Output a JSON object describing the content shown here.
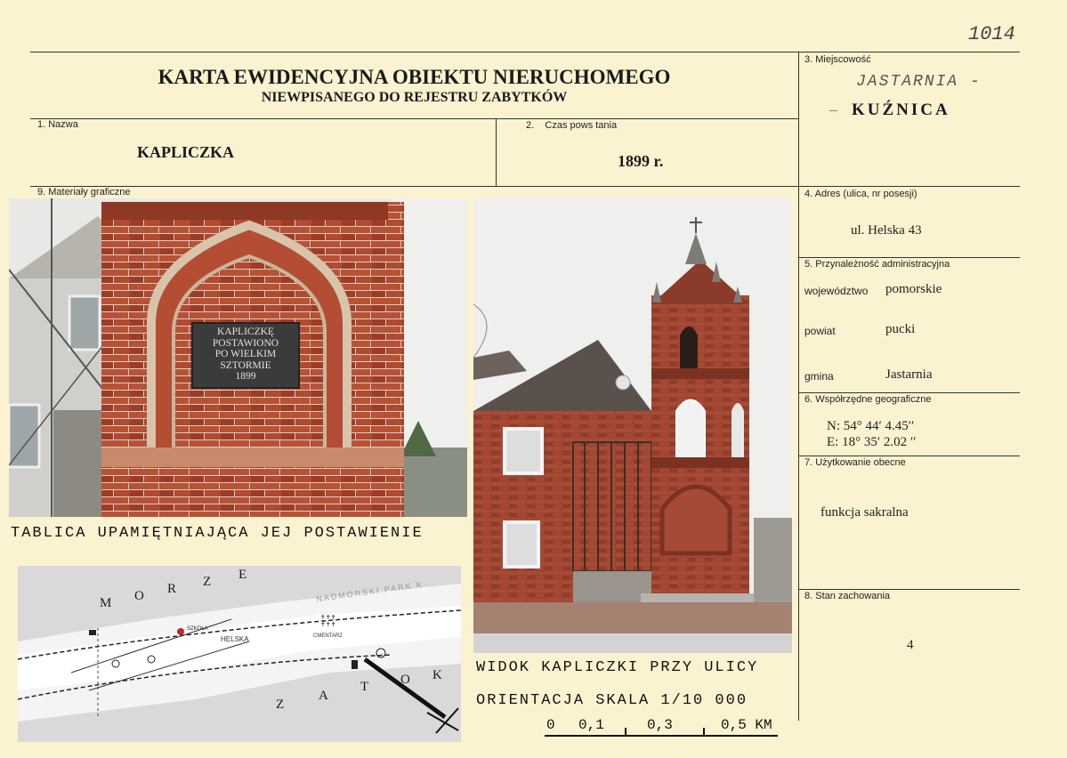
{
  "page_number": "1014",
  "header": {
    "title": "KARTA EWIDENCYJNA OBIEKTU NIERUCHOMEGO",
    "subtitle": "NIEWPISANEGO DO REJESTRU ZABYTKÓW"
  },
  "fields": {
    "miejscowosc": {
      "label": "3. Miejscowość",
      "handwritten": "JASTARNIA -",
      "dash": "–",
      "value": "KUŹNICA"
    },
    "nazwa": {
      "label": "1. Nazwa",
      "value": "KAPLICZKA"
    },
    "czas": {
      "label": "2.    Czas pows tania",
      "value": "1899 r."
    },
    "materialy": {
      "label": "9. Materiały graficzne"
    },
    "adres": {
      "label": "4. Adres (ulica, nr posesji)",
      "value": "ul. Helska 43"
    },
    "przynaleznosc": {
      "label": "5. Przynależność administracyjna",
      "rows": [
        {
          "key": "województwo",
          "value": "pomorskie"
        },
        {
          "key": "powiat",
          "value": "pucki"
        },
        {
          "key": "gmina",
          "value": "Jastarnia"
        }
      ]
    },
    "wspolrzedne": {
      "label": "6. Współrzędne geograficzne",
      "n": "N: 54° 44′ 4.45′′",
      "e": "E: 18° 35′ 2.02 ′′"
    },
    "uzytkowanie": {
      "label": "7. Użytkowanie obecne",
      "value": "funkcja sakralna"
    },
    "stan": {
      "label": "8. Stan zachowania",
      "value": "4"
    }
  },
  "plaque": {
    "lines": [
      "KAPLICZKĘ",
      "POSTAWIONO",
      "PO WIELKIM",
      "SZTORMIE",
      "1899"
    ]
  },
  "captions": {
    "photo1": "TABLICA UPAMIĘTNIAJĄCA JEJ POSTAWIENIE",
    "photo2": "WIDOK KAPLICZKI PRZY ULICY",
    "orientation": "ORIENTACJA SKALA 1/10 000",
    "scale_ticks": [
      "0",
      "0,1",
      "0,3",
      "0,5 KM"
    ]
  },
  "map_labels": {
    "sea_letters": [
      "M",
      "O",
      "R",
      "Z",
      "E"
    ],
    "bay_letters": [
      "Z",
      "A",
      "T",
      "O",
      "K"
    ],
    "park": "NADMORSKI PARK K",
    "street_helska": "HELSKA",
    "cmentarz": "CMENTARZ",
    "szkola": "SZKOŁA"
  },
  "colors": {
    "paper": "#fbf3d0",
    "brick": "#a8442c",
    "plaque": "#3b3b3b"
  }
}
